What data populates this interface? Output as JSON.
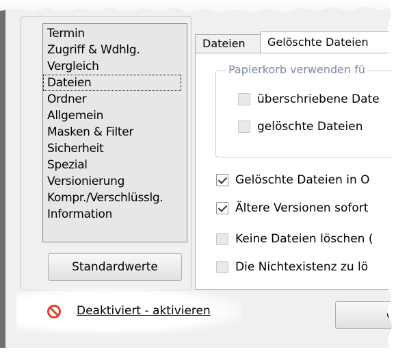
{
  "sidebar": {
    "items": [
      {
        "label": "Termin"
      },
      {
        "label": "Zugriff & Wdhlg."
      },
      {
        "label": "Vergleich"
      },
      {
        "label": "Dateien",
        "selected": true
      },
      {
        "label": "Ordner"
      },
      {
        "label": "Allgemein"
      },
      {
        "label": "Masken & Filter"
      },
      {
        "label": "Sicherheit"
      },
      {
        "label": "Spezial"
      },
      {
        "label": "Versionierung"
      },
      {
        "label": "Kompr./Verschlüsslg."
      },
      {
        "label": "Information"
      }
    ],
    "default_button_label": "Standardwerte"
  },
  "tabs": [
    {
      "label": "Dateien",
      "active": false
    },
    {
      "label": "Gelöschte Dateien",
      "active": true
    }
  ],
  "recycle_group": {
    "title": "Papierkorb verwenden fü",
    "options": [
      {
        "label": "überschriebene Date",
        "checked": false
      },
      {
        "label": "gelöschte Dateien",
        "checked": false
      }
    ]
  },
  "options": [
    {
      "label": "Gelöschte Dateien in O",
      "checked": true
    },
    {
      "label": "Ältere Versionen sofort",
      "checked": true
    },
    {
      "label": "Keine Dateien löschen (",
      "checked": false
    },
    {
      "label": "Die Nichtexistenz zu lö",
      "checked": false
    }
  ],
  "right_button_label": "O",
  "status": {
    "icon": "disabled-icon",
    "link_label": "Deaktiviert - aktivieren",
    "icon_color": "#d9452b"
  }
}
